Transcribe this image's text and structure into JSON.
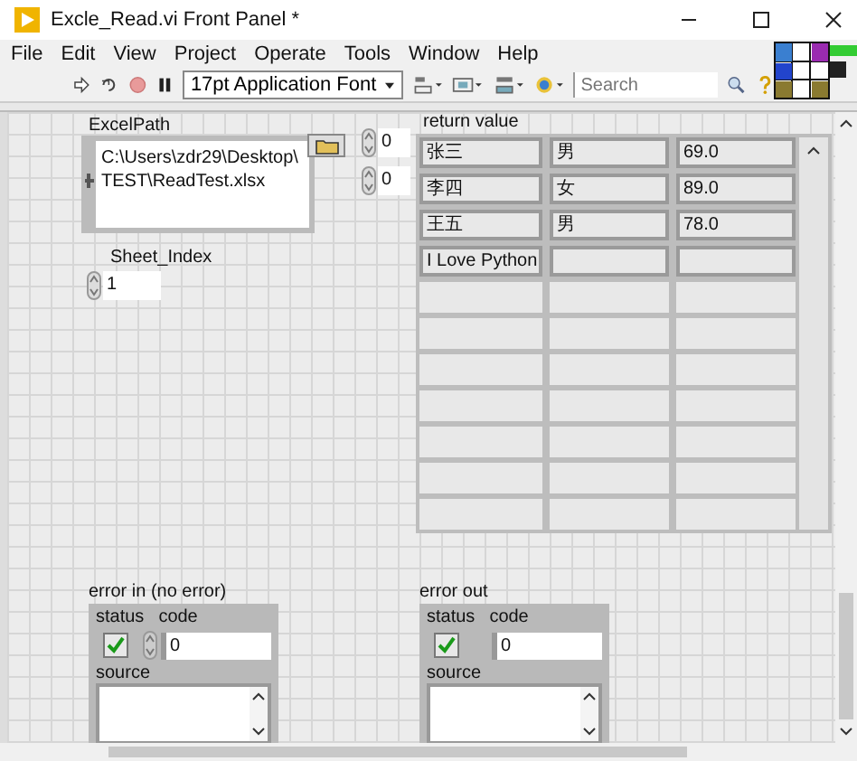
{
  "window": {
    "title": "Excle_Read.vi Front Panel *"
  },
  "menu": [
    "File",
    "Edit",
    "View",
    "Project",
    "Operate",
    "Tools",
    "Window",
    "Help"
  ],
  "toolbar": {
    "font": "17pt Application Font",
    "search_placeholder": "Search"
  },
  "excel_path": {
    "label": "ExcelPath",
    "value_lines": [
      "C:\\Users\\zdr29\\Desktop\\",
      "TEST\\ReadTest.xlsx"
    ]
  },
  "sheet_index": {
    "label": "Sheet_Index",
    "value": "1"
  },
  "return_value": {
    "label": "return value",
    "indices": [
      "0",
      "0"
    ],
    "rows": [
      [
        "张三",
        "男",
        "69.0"
      ],
      [
        "李四",
        "女",
        "89.0"
      ],
      [
        "王五",
        "男",
        "78.0"
      ],
      [
        "I Love Python"
      ]
    ]
  },
  "error_clusters": [
    {
      "label": "error in (no error)",
      "status_label": "status",
      "checked": true,
      "code_label": "code",
      "code": "0",
      "source_label": "source",
      "kind": "control"
    },
    {
      "label": "error out",
      "status_label": "status",
      "checked": true,
      "code_label": "code",
      "code": "0",
      "source_label": "source",
      "kind": "indicator"
    }
  ]
}
